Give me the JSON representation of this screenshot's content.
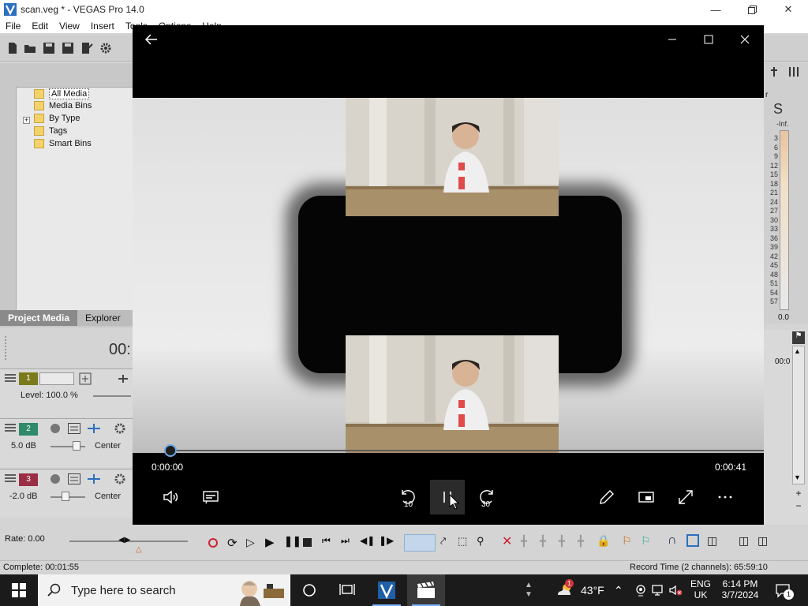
{
  "vegas": {
    "title": "scan.veg * - VEGAS Pro 14.0",
    "menu": [
      "File",
      "Edit",
      "View",
      "Insert",
      "Tools",
      "Options",
      "Help"
    ],
    "tree": {
      "items": [
        "All Media",
        "Media Bins",
        "By Type",
        "Tags",
        "Smart Bins"
      ],
      "expander": "+"
    },
    "tabs": [
      "Project Media",
      "Explorer"
    ],
    "timecode": "00:",
    "tracks": [
      {
        "number": "1",
        "color": "#7a7a1c",
        "level_label": "Level: 100.0 %"
      },
      {
        "number": "2",
        "color": "#2f8a6a",
        "volume": "5.0 dB",
        "pan": "Center"
      },
      {
        "number": "3",
        "color": "#9a2e44",
        "volume": "-2.0 dB",
        "pan": "Center"
      }
    ],
    "rate": "Rate: 0.00",
    "status_left": "Complete: 00:01:55",
    "status_right": "Record Time (2 channels): 65:59:10",
    "meter_header": "S",
    "meter_inf": "-Inf.",
    "meter_scale": [
      "3",
      "6",
      "9",
      "12",
      "15",
      "18",
      "21",
      "24",
      "27",
      "30",
      "33",
      "36",
      "39",
      "42",
      "45",
      "48",
      "51",
      "54",
      "57"
    ],
    "meter_zero": "0.0",
    "right_time": "00:0",
    "right_r": "r"
  },
  "player": {
    "time_current": "0:00:00",
    "time_total": "0:00:41",
    "progress_fraction": 0.0,
    "skip_back_label": "10",
    "skip_forward_label": "30"
  },
  "taskbar": {
    "search_placeholder": "Type here to search",
    "weather_temp": "43°F",
    "weather_badge": "1",
    "lang": "ENG",
    "region": "UK",
    "time": "6:14 PM",
    "date": "3/7/2024",
    "notif_count": "1"
  },
  "colors": {
    "accent": "#6aa9e6",
    "player_bg": "#000000",
    "taskbar_bg": "#1b1b1b"
  }
}
